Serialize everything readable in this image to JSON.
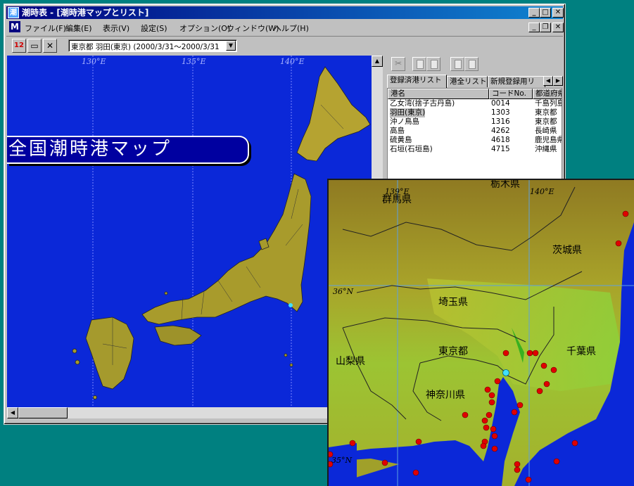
{
  "window": {
    "title": "潮時表 - [潮時港マップとリスト]",
    "app_icon_glyph": "潮"
  },
  "menu": {
    "items": [
      "ファイル(F)",
      "編集(E)",
      "表示(V)",
      "設定(S)",
      "オプション(O)",
      "ウィンドウ(W)",
      "ヘルプ(H)"
    ]
  },
  "toolbar": {
    "calendar_label": "12",
    "combo_value": "東京都 羽田(東京) (2000/3/31～2000/3/31"
  },
  "map": {
    "banner": "全国潮時港マップ",
    "longitudes": [
      "130°E",
      "135°E",
      "140°E"
    ]
  },
  "tabs": {
    "items": [
      "登録済港リスト",
      "港全リスト",
      "新規登録用リ"
    ]
  },
  "list": {
    "headers": [
      "港名",
      "コードNo.",
      "都道府県"
    ],
    "rows": [
      [
        "乙女湾(捨子古丹島)",
        "0014",
        "千島列島"
      ],
      [
        "羽田(東京)",
        "1303",
        "東京都"
      ],
      [
        "沖ノ鳥島",
        "1316",
        "東京都"
      ],
      [
        "高島",
        "4262",
        "長崎県"
      ],
      [
        "硫黄島",
        "4618",
        "鹿児島県"
      ],
      [
        "石垣(石垣島)",
        "4715",
        "沖縄県"
      ]
    ],
    "selected_index": 1
  },
  "detail_map": {
    "prefectures": [
      "群馬県",
      "栃木県",
      "茨城県",
      "埼玉県",
      "東京都",
      "千葉県",
      "山梨県",
      "神奈川県"
    ],
    "coords": [
      "139°E",
      "140°E",
      "36°N",
      "35°N"
    ]
  },
  "colors": {
    "sea": "#0b28d8",
    "title_bar": "#000080",
    "port_marker": "#e00000",
    "selected_port": "#40e0ff"
  }
}
